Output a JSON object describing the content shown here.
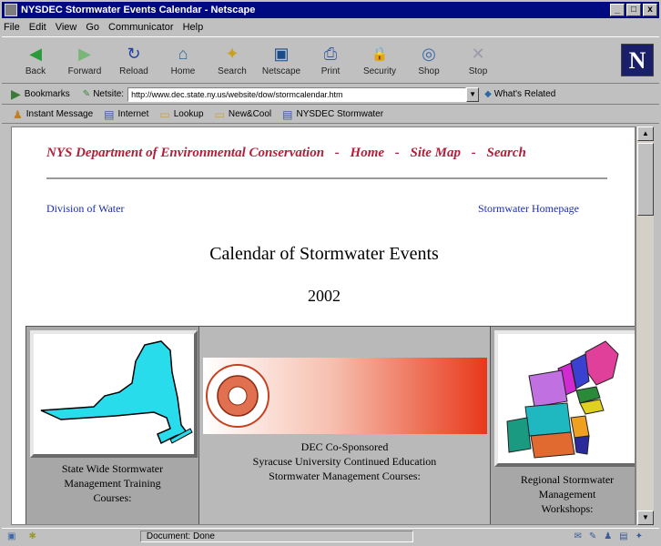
{
  "window": {
    "title": "NYSDEC Stormwater Events Calendar - Netscape",
    "min_btn": "_",
    "max_btn": "□",
    "close_btn": "x"
  },
  "menu": [
    "File",
    "Edit",
    "View",
    "Go",
    "Communicator",
    "Help"
  ],
  "toolbar": {
    "buttons": [
      {
        "label": "Back",
        "icon": "back-arrow-icon",
        "glyph": "◀"
      },
      {
        "label": "Forward",
        "icon": "forward-arrow-icon",
        "glyph": "▶"
      },
      {
        "label": "Reload",
        "icon": "reload-icon",
        "glyph": "↻"
      },
      {
        "label": "Home",
        "icon": "home-icon",
        "glyph": "⌂"
      },
      {
        "label": "Search",
        "icon": "search-icon",
        "glyph": "✦"
      },
      {
        "label": "Netscape",
        "icon": "netscape-icon",
        "glyph": "▣"
      },
      {
        "label": "Print",
        "icon": "print-icon",
        "glyph": "⎙"
      },
      {
        "label": "Security",
        "icon": "lock-icon",
        "glyph": "🔒"
      },
      {
        "label": "Shop",
        "icon": "shop-icon",
        "glyph": "◎"
      },
      {
        "label": "Stop",
        "icon": "stop-icon",
        "glyph": "✕"
      }
    ],
    "logo_letter": "N"
  },
  "location": {
    "bookmarks_label": "Bookmarks",
    "goto_label": "Netsite:",
    "url": "http://www.dec.state.ny.us/website/dow/stormcalendar.htm",
    "dropdown_glyph": "▼",
    "related_label": "What's Related"
  },
  "personal_toolbar": [
    {
      "label": "Instant Message",
      "icon": "person-icon",
      "glyph": "♟"
    },
    {
      "label": "Internet",
      "icon": "bookmark-icon",
      "glyph": "▤"
    },
    {
      "label": "Lookup",
      "icon": "folder-icon",
      "glyph": "▭"
    },
    {
      "label": "New&Cool",
      "icon": "folder-icon",
      "glyph": "▭"
    },
    {
      "label": "NYSDEC Stormwater",
      "icon": "bookmark-icon",
      "glyph": "▤"
    }
  ],
  "page": {
    "header": {
      "dept": "NYS Department of Environmental Conservation",
      "sep": "-",
      "home": "Home",
      "sitemap": "Site Map",
      "search": "Search"
    },
    "link_left": "Division of Water",
    "link_right": "Stormwater Homepage",
    "title": "Calendar of Stormwater Events",
    "year": "2002",
    "courses": {
      "left_caption": [
        "State Wide Stormwater",
        "Management Training",
        "Courses:"
      ],
      "mid_caption": [
        "DEC Co-Sponsored",
        "Syracuse University Continued Education",
        "Stormwater Management Courses:"
      ],
      "right_caption": [
        "Regional Stormwater",
        "Management",
        "Workshops:"
      ]
    }
  },
  "status": {
    "text": "Document: Done"
  },
  "colors": {
    "title_bar": "#000a80",
    "header_red": "#b41e3a",
    "link_blue": "#1a2db0",
    "ny_map": "#29dcec",
    "banner_red": "#e8381a"
  }
}
